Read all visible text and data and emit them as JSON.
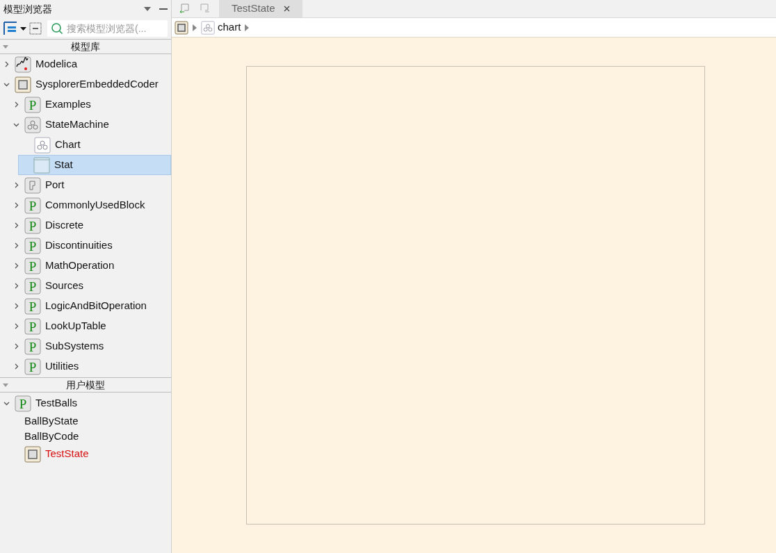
{
  "panel": {
    "title": "模型浏览器",
    "search": {
      "placeholder": "搜索模型浏览器(..."
    }
  },
  "library": {
    "header": "模型库",
    "items": [
      {
        "label": "Modelica",
        "kind": "modelica",
        "expanded": false,
        "selected": false
      },
      {
        "label": "SysplorerEmbeddedCoder",
        "kind": "chip",
        "expanded": true,
        "selected": false,
        "children": [
          {
            "label": "Examples",
            "kind": "package",
            "icon_letter": "P",
            "expanded": false,
            "selected": false
          },
          {
            "label": "StateMachine",
            "kind": "statemachine",
            "expanded": true,
            "selected": false,
            "children": [
              {
                "label": "Chart",
                "kind": "chart",
                "selected": false
              },
              {
                "label": "Stat",
                "kind": "state",
                "selected": true
              }
            ]
          },
          {
            "label": "Port",
            "kind": "port",
            "expanded": false,
            "selected": false
          },
          {
            "label": "CommonlyUsedBlock",
            "kind": "package",
            "icon_letter": "P",
            "expanded": false,
            "selected": false
          },
          {
            "label": "Discrete",
            "kind": "package",
            "icon_letter": "P",
            "expanded": false,
            "selected": false
          },
          {
            "label": "Discontinuities",
            "kind": "package",
            "icon_letter": "P",
            "expanded": false,
            "selected": false
          },
          {
            "label": "MathOperation",
            "kind": "package",
            "icon_letter": "P",
            "expanded": false,
            "selected": false
          },
          {
            "label": "Sources",
            "kind": "package",
            "icon_letter": "P",
            "expanded": false,
            "selected": false
          },
          {
            "label": "LogicAndBitOperation",
            "kind": "package",
            "icon_letter": "P",
            "expanded": false,
            "selected": false
          },
          {
            "label": "LookUpTable",
            "kind": "package",
            "icon_letter": "P",
            "expanded": false,
            "selected": false
          },
          {
            "label": "SubSystems",
            "kind": "package",
            "icon_letter": "P",
            "expanded": false,
            "selected": false
          },
          {
            "label": "Utilities",
            "kind": "package",
            "icon_letter": "P",
            "expanded": false,
            "selected": false
          }
        ]
      }
    ]
  },
  "user_models": {
    "header": "用户模型",
    "items": [
      {
        "label": "TestBalls",
        "kind": "package",
        "icon_letter": "P",
        "expanded": true,
        "selected": false,
        "children": [
          {
            "label": "BallByState",
            "kind": "plain",
            "selected": false
          },
          {
            "label": "BallByCode",
            "kind": "plain",
            "selected": false
          },
          {
            "label": "TestState",
            "kind": "chip",
            "selected": false,
            "modified": true
          }
        ]
      }
    ]
  },
  "editor": {
    "tabs": [
      {
        "label": "TestState",
        "selected": true
      }
    ],
    "breadcrumb": [
      {
        "label": "chart"
      }
    ]
  }
}
